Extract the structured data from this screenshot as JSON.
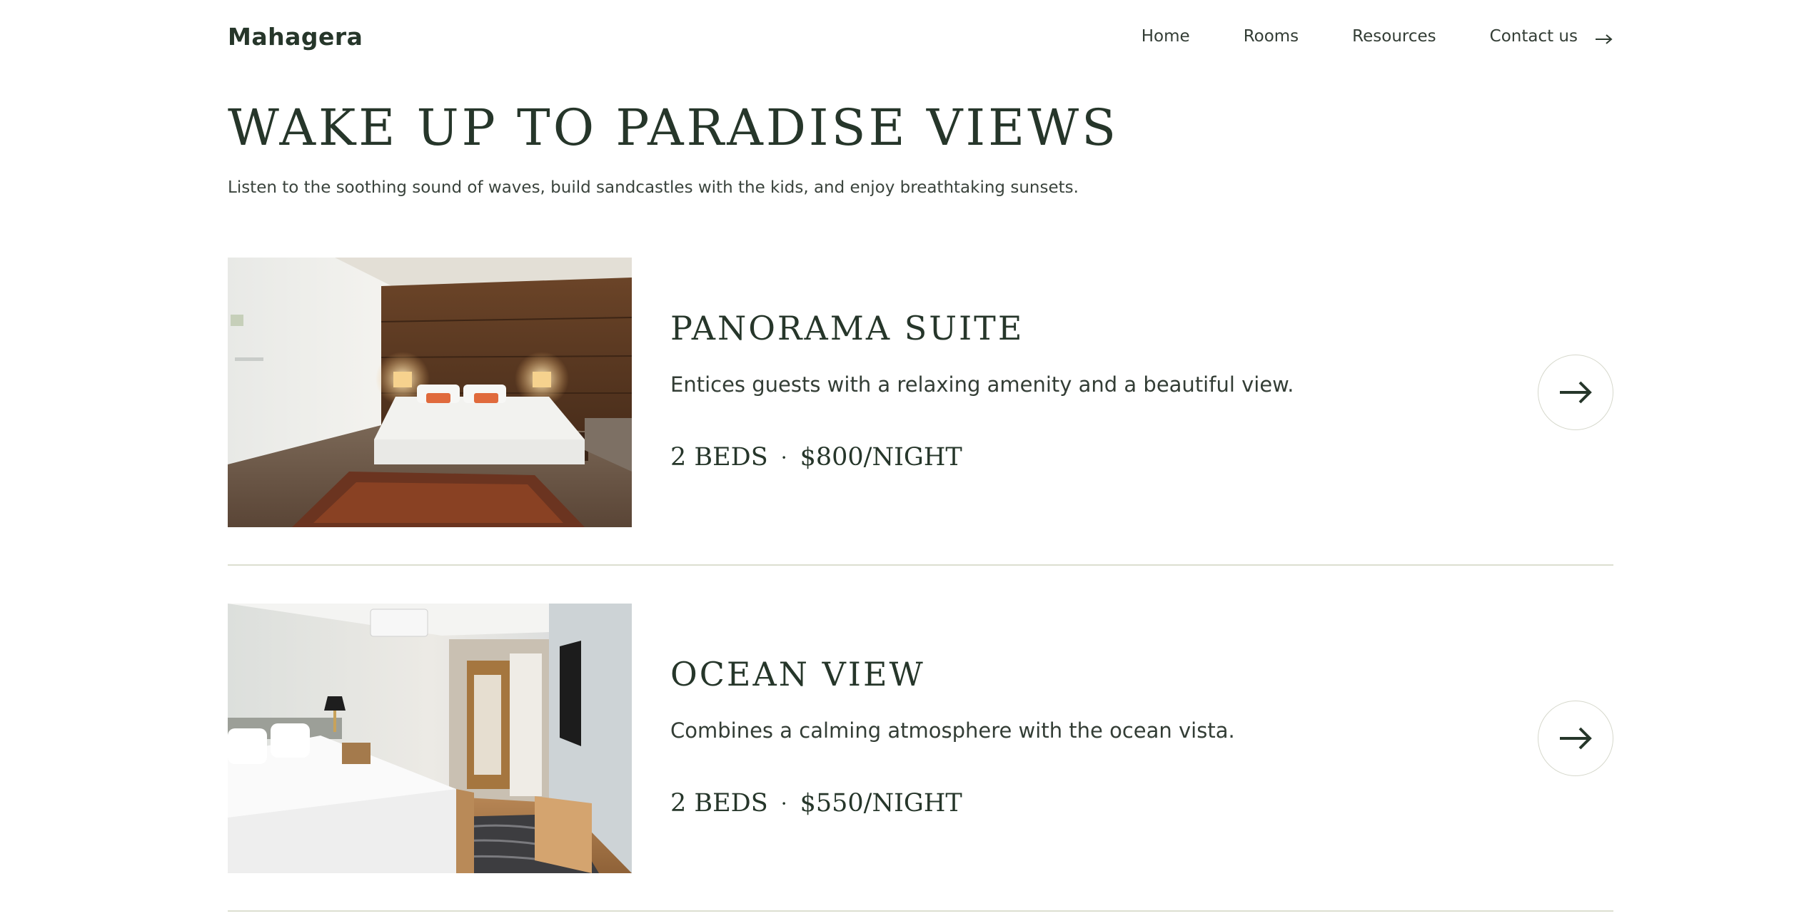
{
  "header": {
    "logo": "Mahagera",
    "nav": [
      {
        "label": "Home"
      },
      {
        "label": "Rooms"
      },
      {
        "label": "Resources"
      },
      {
        "label": "Contact us"
      }
    ],
    "contact_icon": "arrow-right-icon"
  },
  "hero": {
    "title": "WAKE UP TO PARADISE VIEWS",
    "subtitle": "Listen to the soothing sound of waves, build sandcastles with the kids, and enjoy breathtaking sunsets."
  },
  "rooms": [
    {
      "name": "PANORAMA SUITE",
      "description": "Entices guests with a relaxing amenity and a beautiful view.",
      "beds": "2 BEDS",
      "separator": "·",
      "price": "$800/NIGHT",
      "image": "hotel-room-wood-panel-photo",
      "button_icon": "arrow-right-icon"
    },
    {
      "name": "OCEAN VIEW",
      "description": "Combines a calming atmosphere with the ocean vista.",
      "beds": "2 BEDS",
      "separator": "·",
      "price": "$550/NIGHT",
      "image": "hotel-room-white-bed-photo",
      "button_icon": "arrow-right-icon"
    }
  ],
  "colors": {
    "text_dark_green": "#26362a",
    "divider": "#dcdfd0",
    "button_border": "#d6d8cc"
  }
}
